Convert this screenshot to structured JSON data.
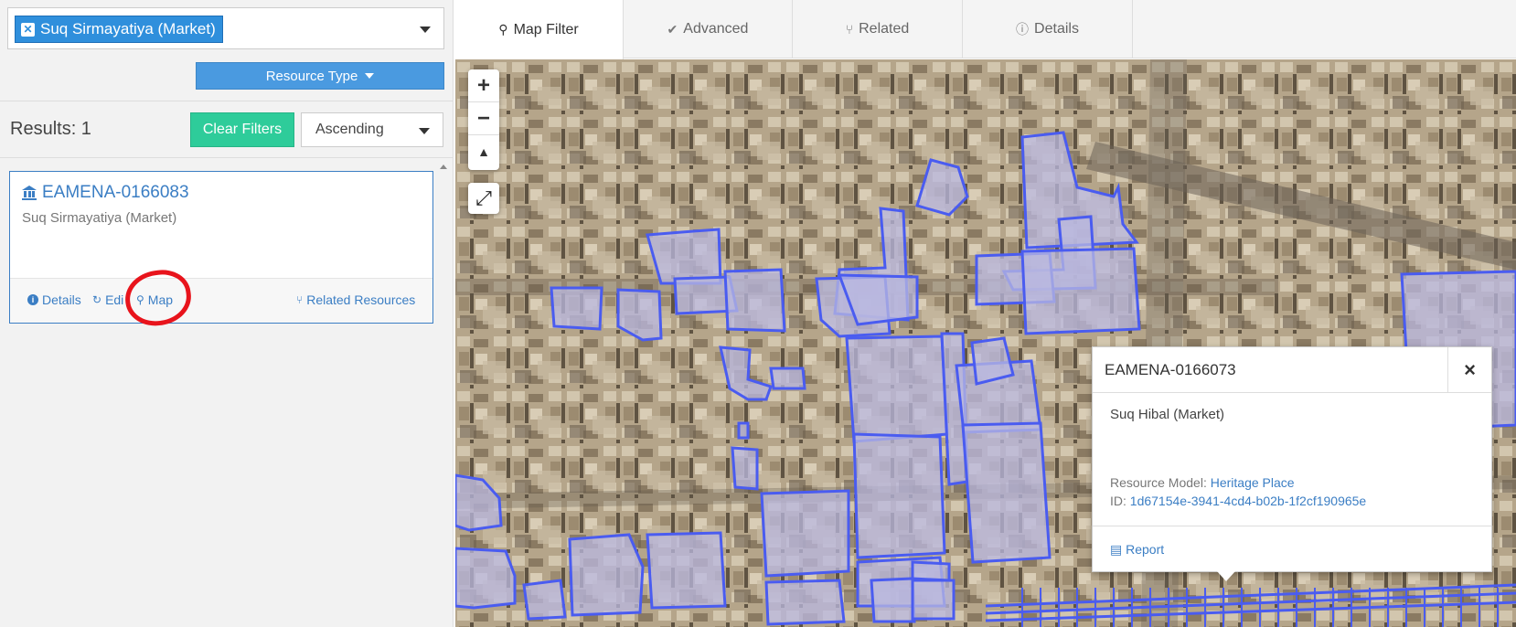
{
  "filters": {
    "active_tag": "Suq Sirmayatiya (Market)",
    "resource_type_label": "Resource Type"
  },
  "results": {
    "count_label": "Results: 1",
    "clear_label": "Clear Filters",
    "sort_value": "Ascending"
  },
  "card": {
    "id": "EAMENA-0166083",
    "name": "Suq Sirmayatiya (Market)",
    "details_label": "Details",
    "edit_label": "Edi",
    "map_label": "Map",
    "related_label": "Related Resources"
  },
  "tabs": [
    {
      "label": "Map Filter",
      "icon": "map-marker-icon"
    },
    {
      "label": "Advanced",
      "icon": "check-circle-icon"
    },
    {
      "label": "Related",
      "icon": "code-fork-icon"
    },
    {
      "label": "Details",
      "icon": "info-circle-icon"
    }
  ],
  "map": {
    "zoom_in": "+",
    "zoom_out": "−",
    "reset_north": "▲",
    "fullscreen": "⤢"
  },
  "popup": {
    "id": "EAMENA-0166073",
    "name": "Suq Hibal (Market)",
    "model_label": "Resource Model:",
    "model_value": "Heritage Place",
    "id_label": "ID:",
    "id_value": "1d67154e-3941-4cd4-b02b-1f2cf190965e",
    "report_label": "Report",
    "close": "×"
  },
  "colors": {
    "accent": "#3b7ec4",
    "clear_button": "#2ecc9a",
    "polygon_stroke": "#4a5cf0",
    "annotation": "#e8141c"
  }
}
